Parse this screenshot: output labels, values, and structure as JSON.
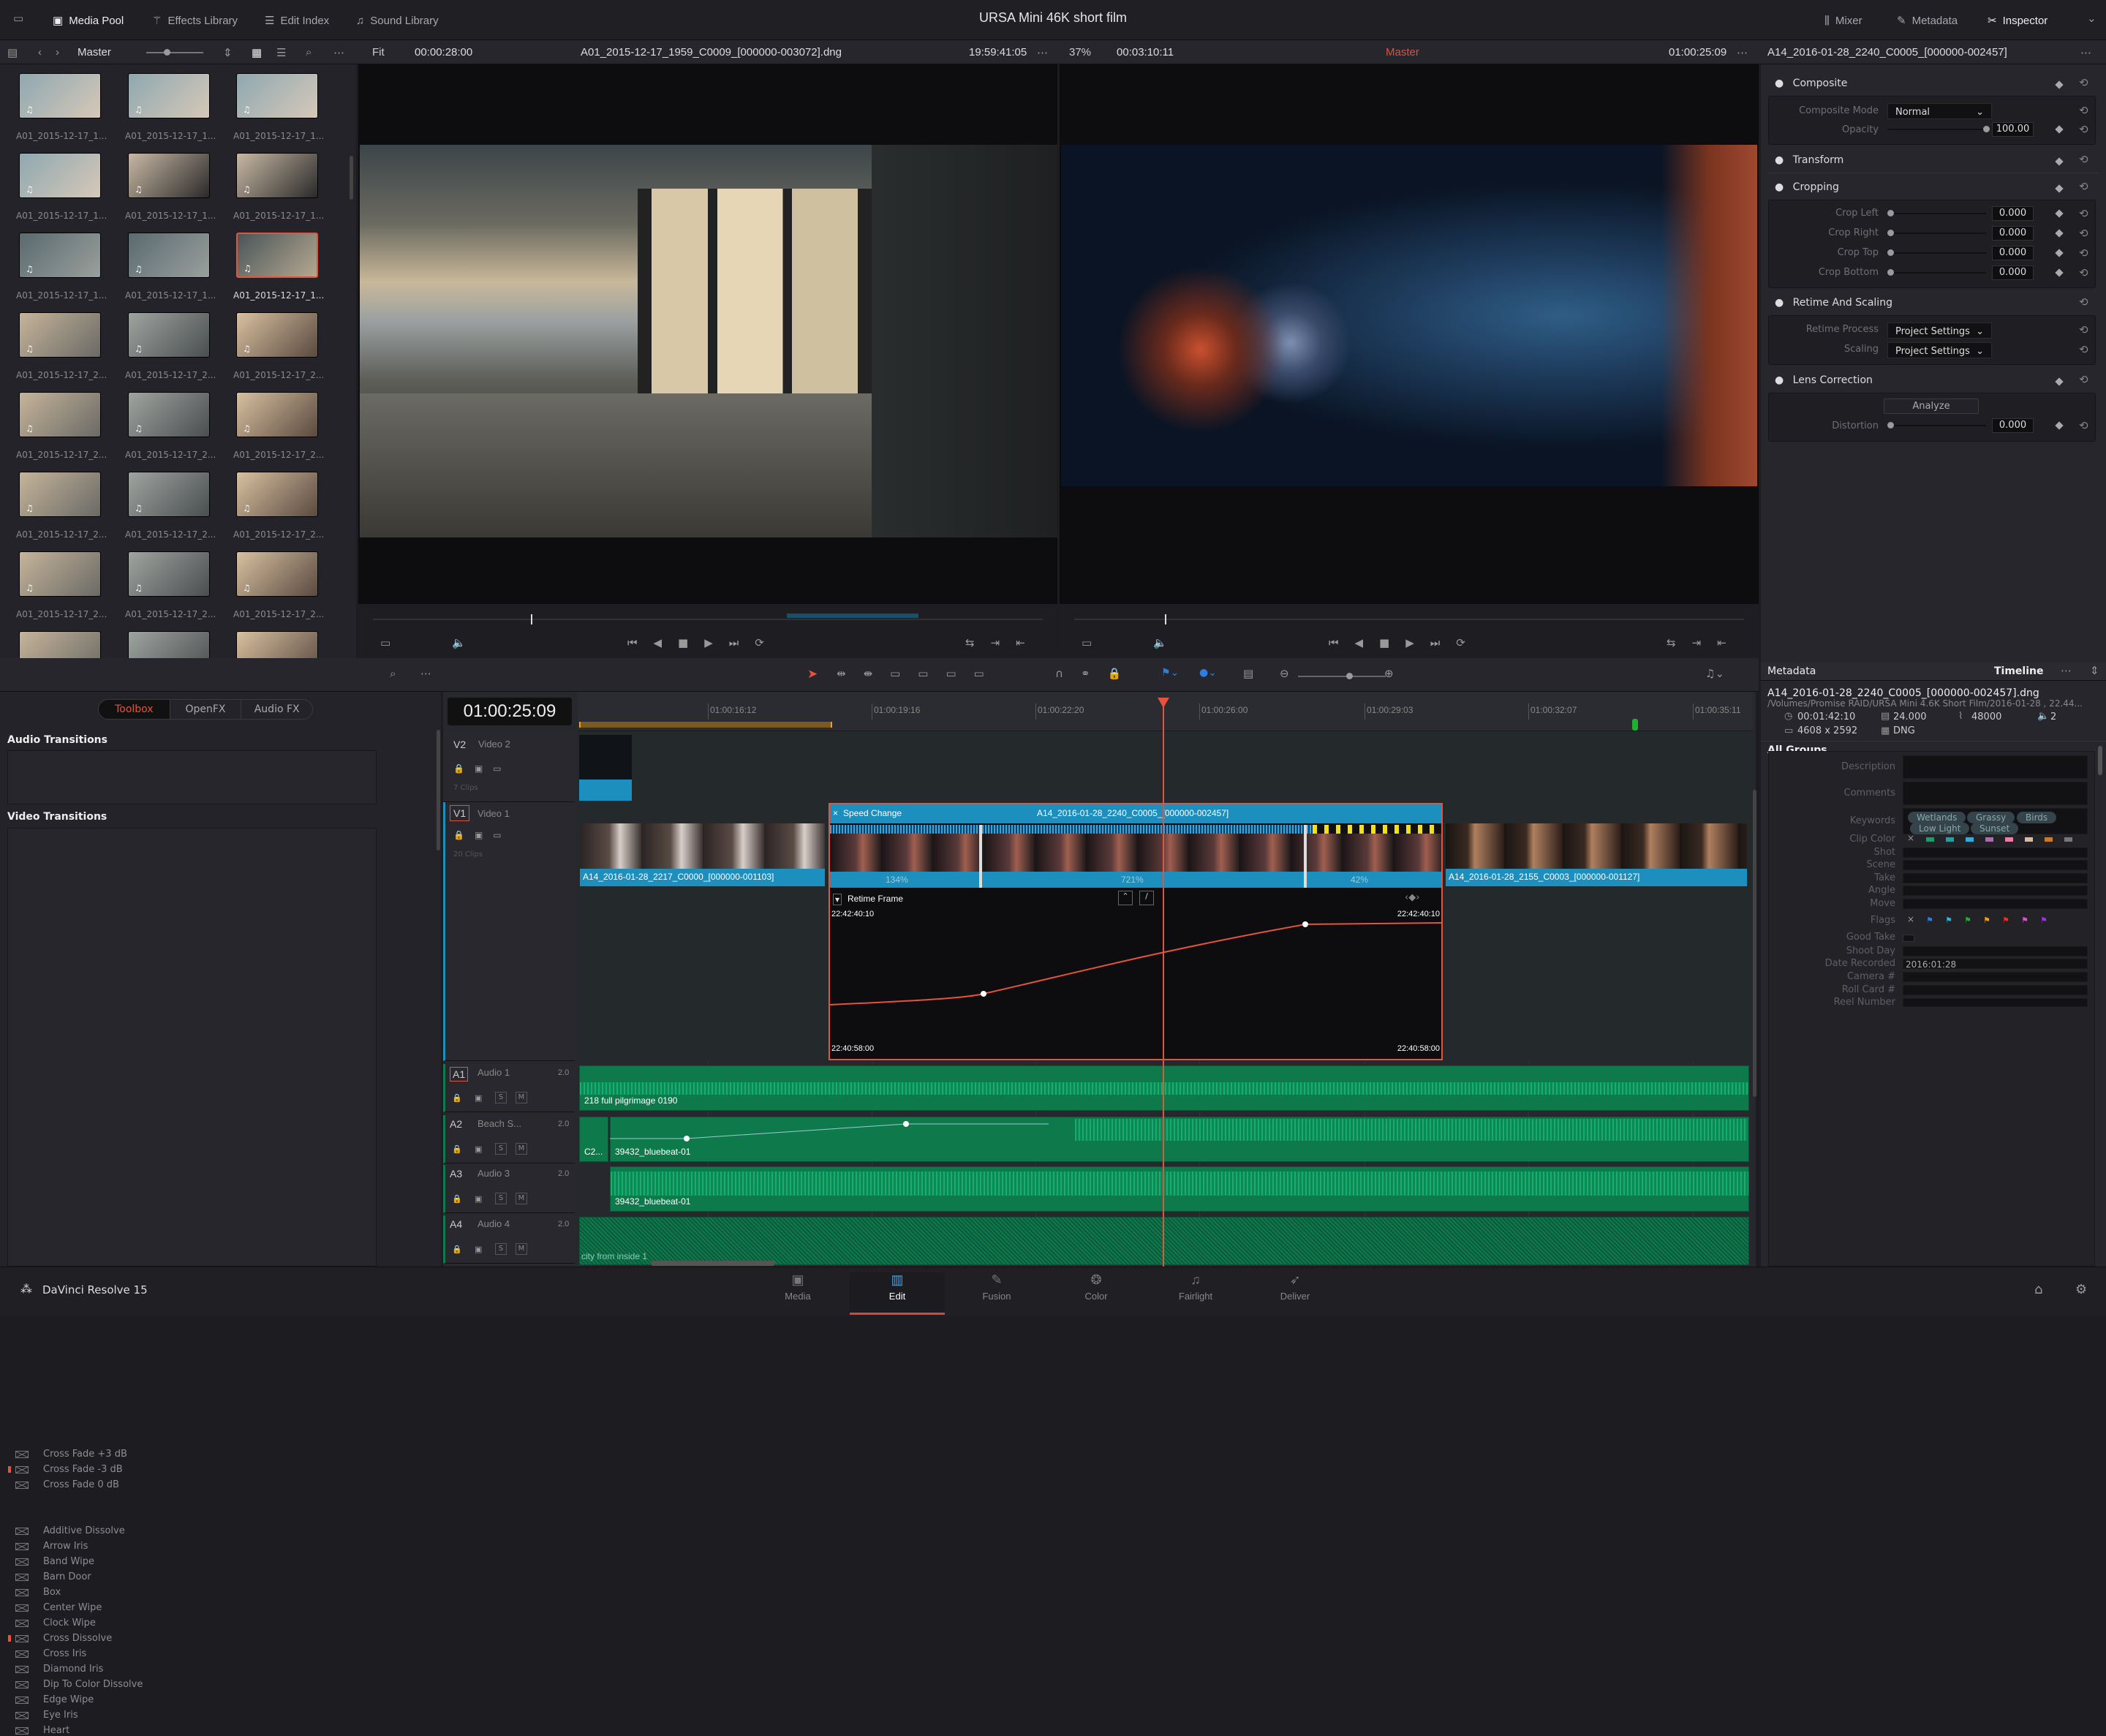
{
  "app": {
    "project_title": "URSA Mini 46K short film",
    "brand": "DaVinci Resolve 15"
  },
  "top_tabs": [
    {
      "label": "Media Pool",
      "icon": "media-pool-icon",
      "active": true
    },
    {
      "label": "Effects Library",
      "icon": "effects-wand-icon",
      "active": false
    },
    {
      "label": "Edit Index",
      "icon": "list-icon",
      "active": false
    },
    {
      "label": "Sound Library",
      "icon": "music-note-icon",
      "active": false
    }
  ],
  "right_tabs": [
    {
      "label": "Mixer",
      "icon": "mixer-icon",
      "active": false
    },
    {
      "label": "Metadata",
      "icon": "metadata-icon",
      "active": false
    },
    {
      "label": "Inspector",
      "icon": "inspector-icon",
      "active": true
    }
  ],
  "media_pool": {
    "bin": "Master",
    "clips": [
      "A01_2015-12-17_1...",
      "A01_2015-12-17_1...",
      "A01_2015-12-17_1...",
      "A01_2015-12-17_1...",
      "A01_2015-12-17_1...",
      "A01_2015-12-17_1...",
      "A01_2015-12-17_1...",
      "A01_2015-12-17_1...",
      "A01_2015-12-17_1...",
      "A01_2015-12-17_2...",
      "A01_2015-12-17_2...",
      "A01_2015-12-17_2...",
      "A01_2015-12-17_2...",
      "A01_2015-12-17_2...",
      "A01_2015-12-17_2...",
      "A01_2015-12-17_2...",
      "A01_2015-12-17_2...",
      "A01_2015-12-17_2...",
      "A01_2015-12-17_2...",
      "A01_2015-12-17_2...",
      "A01_2015-12-17_2...",
      "",
      "",
      ""
    ],
    "selected_index": 8
  },
  "source_viewer": {
    "zoom": "Fit",
    "duration": "00:00:28:00",
    "clip_name": "A01_2015-12-17_1959_C0009_[000000-003072].dng",
    "timecode": "19:59:41:05"
  },
  "program_viewer": {
    "zoom": "37%",
    "duration": "00:03:10:11",
    "timeline": "Master",
    "timecode": "01:00:25:09"
  },
  "inspector": {
    "clip_name": "A14_2016-01-28_2240_C0005_[000000-002457]",
    "composite": {
      "title": "Composite",
      "mode_label": "Composite Mode",
      "mode": "Normal",
      "opacity_label": "Opacity",
      "opacity": "100.00"
    },
    "transform": {
      "title": "Transform"
    },
    "cropping": {
      "title": "Cropping",
      "rows": [
        {
          "label": "Crop Left",
          "value": "0.000"
        },
        {
          "label": "Crop Right",
          "value": "0.000"
        },
        {
          "label": "Crop Top",
          "value": "0.000"
        },
        {
          "label": "Crop Bottom",
          "value": "0.000"
        }
      ]
    },
    "retime": {
      "title": "Retime And Scaling",
      "process_label": "Retime Process",
      "process": "Project Settings",
      "scaling_label": "Scaling",
      "scaling": "Project Settings"
    },
    "lens": {
      "title": "Lens Correction",
      "analyze": "Analyze",
      "distortion_label": "Distortion",
      "distortion": "0.000"
    }
  },
  "effects": {
    "tabs": [
      "Toolbox",
      "OpenFX",
      "Audio FX"
    ],
    "audio_title": "Audio Transitions",
    "audio": [
      "Cross Fade +3 dB",
      "Cross Fade -3 dB",
      "Cross Fade 0 dB"
    ],
    "video_title": "Video Transitions",
    "video": [
      "Additive Dissolve",
      "Arrow Iris",
      "Band Wipe",
      "Barn Door",
      "Box",
      "Center Wipe",
      "Clock Wipe",
      "Cross Dissolve",
      "Cross Iris",
      "Diamond Iris",
      "Dip To Color Dissolve",
      "Edge Wipe",
      "Eye Iris",
      "Heart"
    ],
    "marked": [
      "Cross Fade -3 dB",
      "Cross Dissolve"
    ]
  },
  "timeline": {
    "timecode": "01:00:25:09",
    "ruler": [
      "01:00:16:12",
      "01:00:19:16",
      "01:00:22:20",
      "01:00:26:00",
      "01:00:29:03",
      "01:00:32:07",
      "01:00:35:11"
    ],
    "tracks": {
      "v2": {
        "id": "V2",
        "name": "Video 2",
        "clips": "7 Clips"
      },
      "v1": {
        "id": "V1",
        "name": "Video 1",
        "clips": "20 Clips"
      },
      "a1": {
        "id": "A1",
        "name": "Audio 1",
        "ch": "2.0"
      },
      "a2": {
        "id": "A2",
        "name": "Beach S...",
        "ch": "2.0"
      },
      "a3": {
        "id": "A3",
        "name": "Audio 3",
        "ch": "2.0"
      },
      "a4": {
        "id": "A4",
        "name": "Audio 4",
        "ch": "2.0"
      }
    },
    "v1_clips": {
      "left": "A14_2016-01-28_2217_C0000_[000000-001103]",
      "right": "A14_2016-01-28_2155_C0003_[000000-001127]"
    },
    "speed_change": {
      "label": "Speed Change",
      "clip": "A14_2016-01-28_2240_C0005_[000000-002457]",
      "speeds": [
        "134%",
        "721%",
        "42%"
      ]
    },
    "retime_frame": {
      "label": "Retime Frame",
      "top_left": "22:42:40:10",
      "top_right": "22:42:40:10",
      "bottom_left": "22:40:58:00",
      "bottom_right": "22:40:58:00"
    },
    "audio_clips": {
      "a1": "218 full pilgrimage 0190",
      "a2_prev": "C2...",
      "a2": "39432_bluebeat-01",
      "a3": "39432_bluebeat-01",
      "a4": "city from inside 1"
    },
    "solo": "S",
    "mute": "M"
  },
  "metadata": {
    "title": "Metadata",
    "scope": "Timeline",
    "file": "A14_2016-01-28_2240_C0005_[000000-002457].dng",
    "path": "/Volumes/Promise RAID/URSA Mini 4.6K Short Film/2016-01-28 , 22.44...",
    "duration": "00:01:42:10",
    "fps": "24.000",
    "sample_rate": "48000",
    "channels": "2",
    "resolution": "4608 x 2592",
    "codec": "DNG",
    "group": "All Groups",
    "fields": {
      "description": "Description",
      "comments": "Comments",
      "keywords": "Keywords",
      "clip_color": "Clip Color",
      "shot": "Shot",
      "scene": "Scene",
      "take": "Take",
      "angle": "Angle",
      "move": "Move",
      "flags": "Flags",
      "good_take": "Good Take",
      "shoot_day": "Shoot Day",
      "date_recorded": "Date Recorded",
      "camera": "Camera #",
      "roll_card": "Roll Card #",
      "reel": "Reel Number"
    },
    "keywords": [
      "Wetlands",
      "Grassy",
      "Birds",
      "Low Light",
      "Sunset"
    ],
    "date_recorded": "2016:01:28",
    "clip_colors": [
      "#1e9a6a",
      "#1aa3a3",
      "#2ab0e0",
      "#b06ab0",
      "#f07aa8",
      "#d8bca0",
      "#d07a20",
      "#777777"
    ],
    "flag_colors": [
      "#2a7fe0",
      "#2ab8d8",
      "#20b030",
      "#f0a020",
      "#e83020",
      "#e050d0",
      "#a030e0"
    ]
  },
  "pages": [
    "Media",
    "Edit",
    "Fusion",
    "Color",
    "Fairlight",
    "Deliver"
  ],
  "active_page": "Edit",
  "colors": {
    "accent": "#e5533c",
    "clip_blue": "#1d8fbf",
    "audio_green": "#0e7a4c"
  }
}
